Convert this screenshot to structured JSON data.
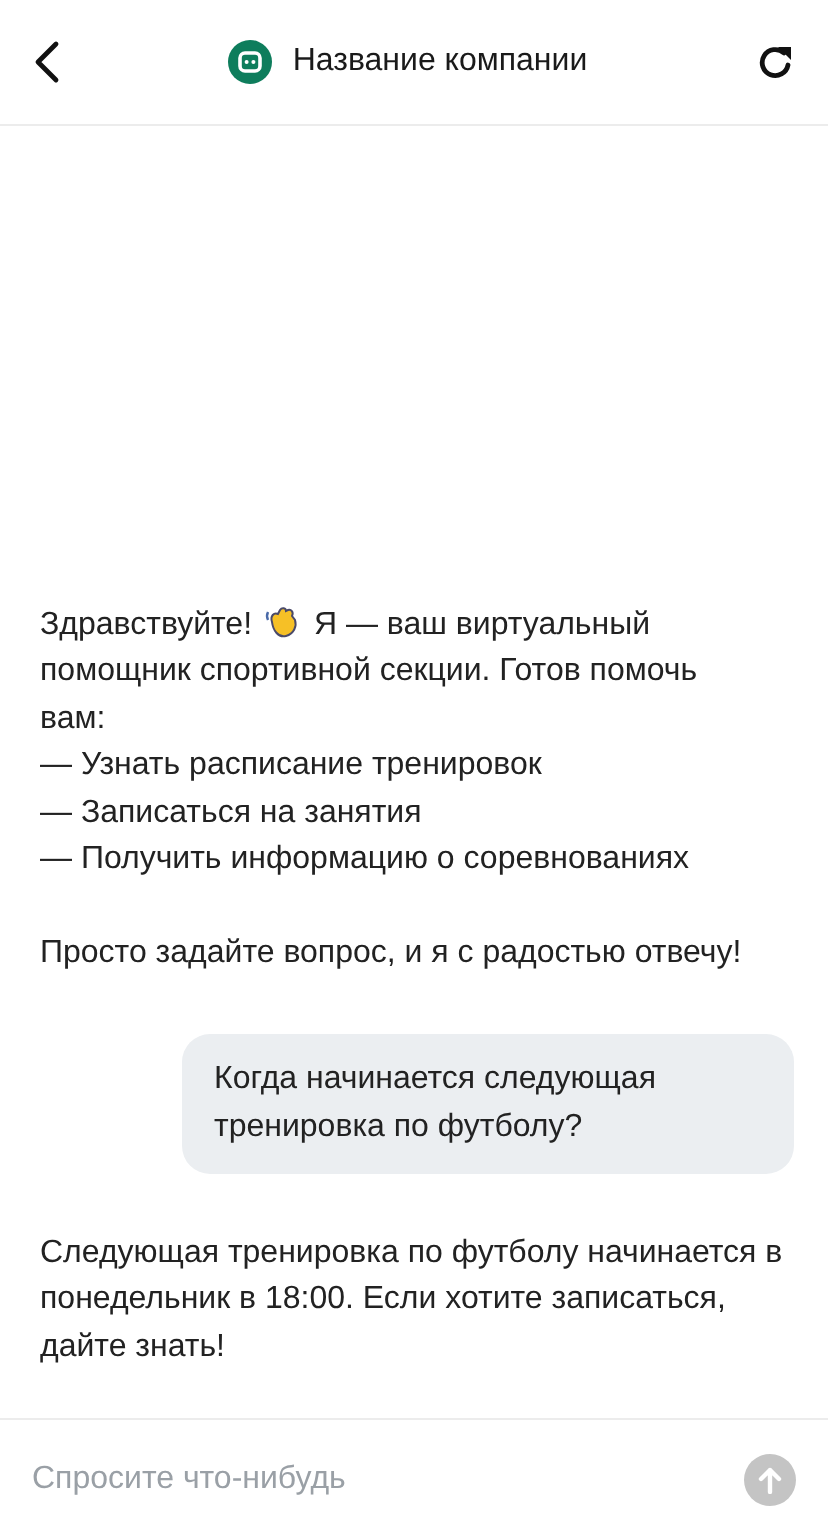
{
  "header": {
    "title": "Название компании"
  },
  "messages": [
    {
      "kind": "bot",
      "intro_before": "Здравствуйте!",
      "intro_after": "Я — ваш виртуальный",
      "intro_rest": "помощник спортивной секции. Готов помочь вам:",
      "items": [
        "— Узнать расписание тренировок",
        "— Записаться на занятия",
        "— Получить информацию о соревнованиях"
      ],
      "closing": "Просто задайте вопрос, и я с радостью отвечу!"
    },
    {
      "kind": "user",
      "text": "Когда начинается следующая тренировка по футболу?"
    },
    {
      "kind": "bot",
      "text": "Следующая тренировка по футболу начинается в понедельник в 18:00. Если хотите записаться, дайте знать!"
    }
  ],
  "composer": {
    "placeholder": "Спросите что-нибудь"
  }
}
